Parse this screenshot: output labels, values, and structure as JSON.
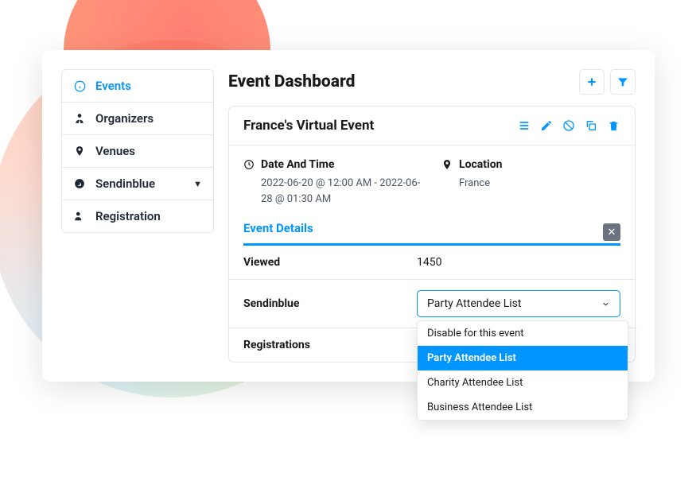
{
  "sidebar": {
    "items": [
      {
        "label": "Events",
        "active": true
      },
      {
        "label": "Organizers"
      },
      {
        "label": "Venues"
      },
      {
        "label": "Sendinblue",
        "expandable": true
      },
      {
        "label": "Registration"
      }
    ]
  },
  "main": {
    "title": "Event Dashboard"
  },
  "event": {
    "title": "France's Virtual Event",
    "date_label": "Date And Time",
    "date_value": "2022-06-20 @ 12:00 AM - 2022-06-28 @ 01:30 AM",
    "location_label": "Location",
    "location_value": "France",
    "details_title": "Event Details",
    "details": {
      "viewed_label": "Viewed",
      "viewed_value": "1450",
      "sendinblue_label": "Sendinblue",
      "sendinblue_selected": "Party Attendee List",
      "sendinblue_options": [
        "Disable for this event",
        "Party Attendee List",
        "Charity Attendee List",
        "Business Attendee List"
      ],
      "registrations_label": "Registrations"
    }
  }
}
